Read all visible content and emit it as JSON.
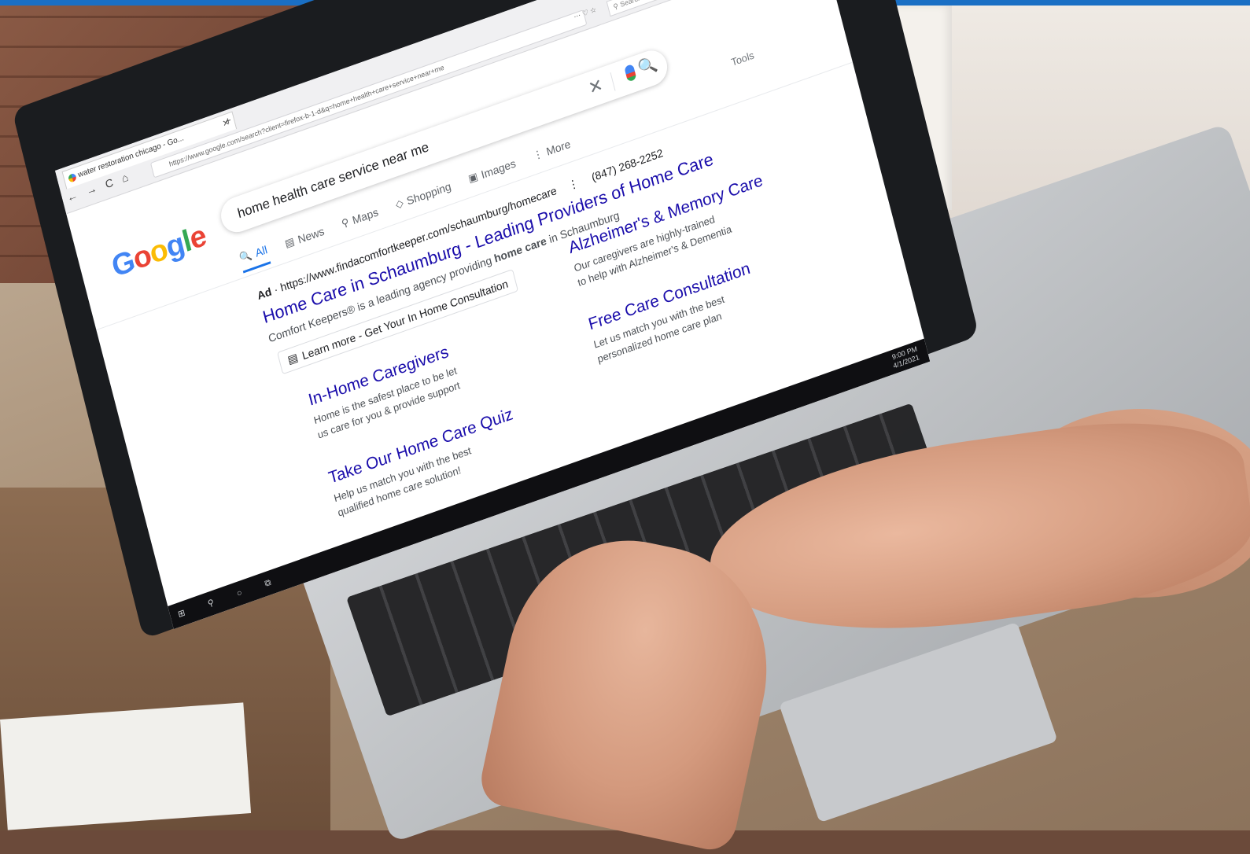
{
  "browser": {
    "tab_title": "water restoration chicago - Go...",
    "tab_close": "✕",
    "new_tab": "+",
    "url": "https://www.google.com/search?client=firefox-b-1-d&q=home+health+care+service+near+me",
    "url_tools": "⋯ ♡ ☆",
    "firefox_search_placeholder": "Search",
    "nav_icons": [
      "←",
      "→",
      "C",
      "⌂"
    ],
    "window_controls": "– ◻ ✕"
  },
  "google": {
    "logo": [
      {
        "ch": "G",
        "color": "#4285f4"
      },
      {
        "ch": "o",
        "color": "#ea4335"
      },
      {
        "ch": "o",
        "color": "#fbbc05"
      },
      {
        "ch": "g",
        "color": "#4285f4"
      },
      {
        "ch": "l",
        "color": "#34a853"
      },
      {
        "ch": "e",
        "color": "#ea4335"
      }
    ],
    "search_query": "home health care service near me",
    "clear_icon": "✕",
    "search_icon": "🔍",
    "tools": "Tools",
    "tabs": [
      {
        "label": "All",
        "icon": "search-icon",
        "glyph": "🔍"
      },
      {
        "label": "News",
        "icon": "news-icon",
        "glyph": "▤"
      },
      {
        "label": "Maps",
        "icon": "map-pin-icon",
        "glyph": "⚲"
      },
      {
        "label": "Shopping",
        "icon": "tag-icon",
        "glyph": "◇"
      },
      {
        "label": "Images",
        "icon": "image-icon",
        "glyph": "▣"
      },
      {
        "label": "More",
        "icon": "more-icon",
        "glyph": "⋮"
      }
    ]
  },
  "ad": {
    "label": "Ad",
    "separator": " · ",
    "url": "https://www.findacomfortkeeper.com/schaumburg/homecare",
    "menu": "⋮",
    "phone": "(847) 268-2252",
    "title": "Home Care in Schaumburg - Leading Providers of Home Care",
    "desc_before": "Comfort Keepers® is a leading agency providing ",
    "desc_bold": "home care",
    "desc_after": " in Schaumburg",
    "button_label": "Learn more - Get Your In Home Consultation",
    "button_icon": "▤",
    "sitelinks": [
      {
        "title": "In-Home Caregivers",
        "line1": "Home is the safest place to be let",
        "line2": "us care for you & provide support"
      },
      {
        "title": "Alzheimer's & Memory Care",
        "line1": "Our caregivers are highly-trained",
        "line2": "to help with Alzheimer's & Dementia"
      },
      {
        "title": "Take Our Home Care Quiz",
        "line1": "Help us match you with the best",
        "line2": "qualified home care solution!"
      },
      {
        "title": "Free Care Consultation",
        "line1": "Let us match you with the best",
        "line2": "personalized home care plan"
      }
    ]
  },
  "taskbar": {
    "left_icons": "⊞ ⚲ ○ ⧉",
    "time": "9:00 PM",
    "date": "4/1/2021"
  }
}
